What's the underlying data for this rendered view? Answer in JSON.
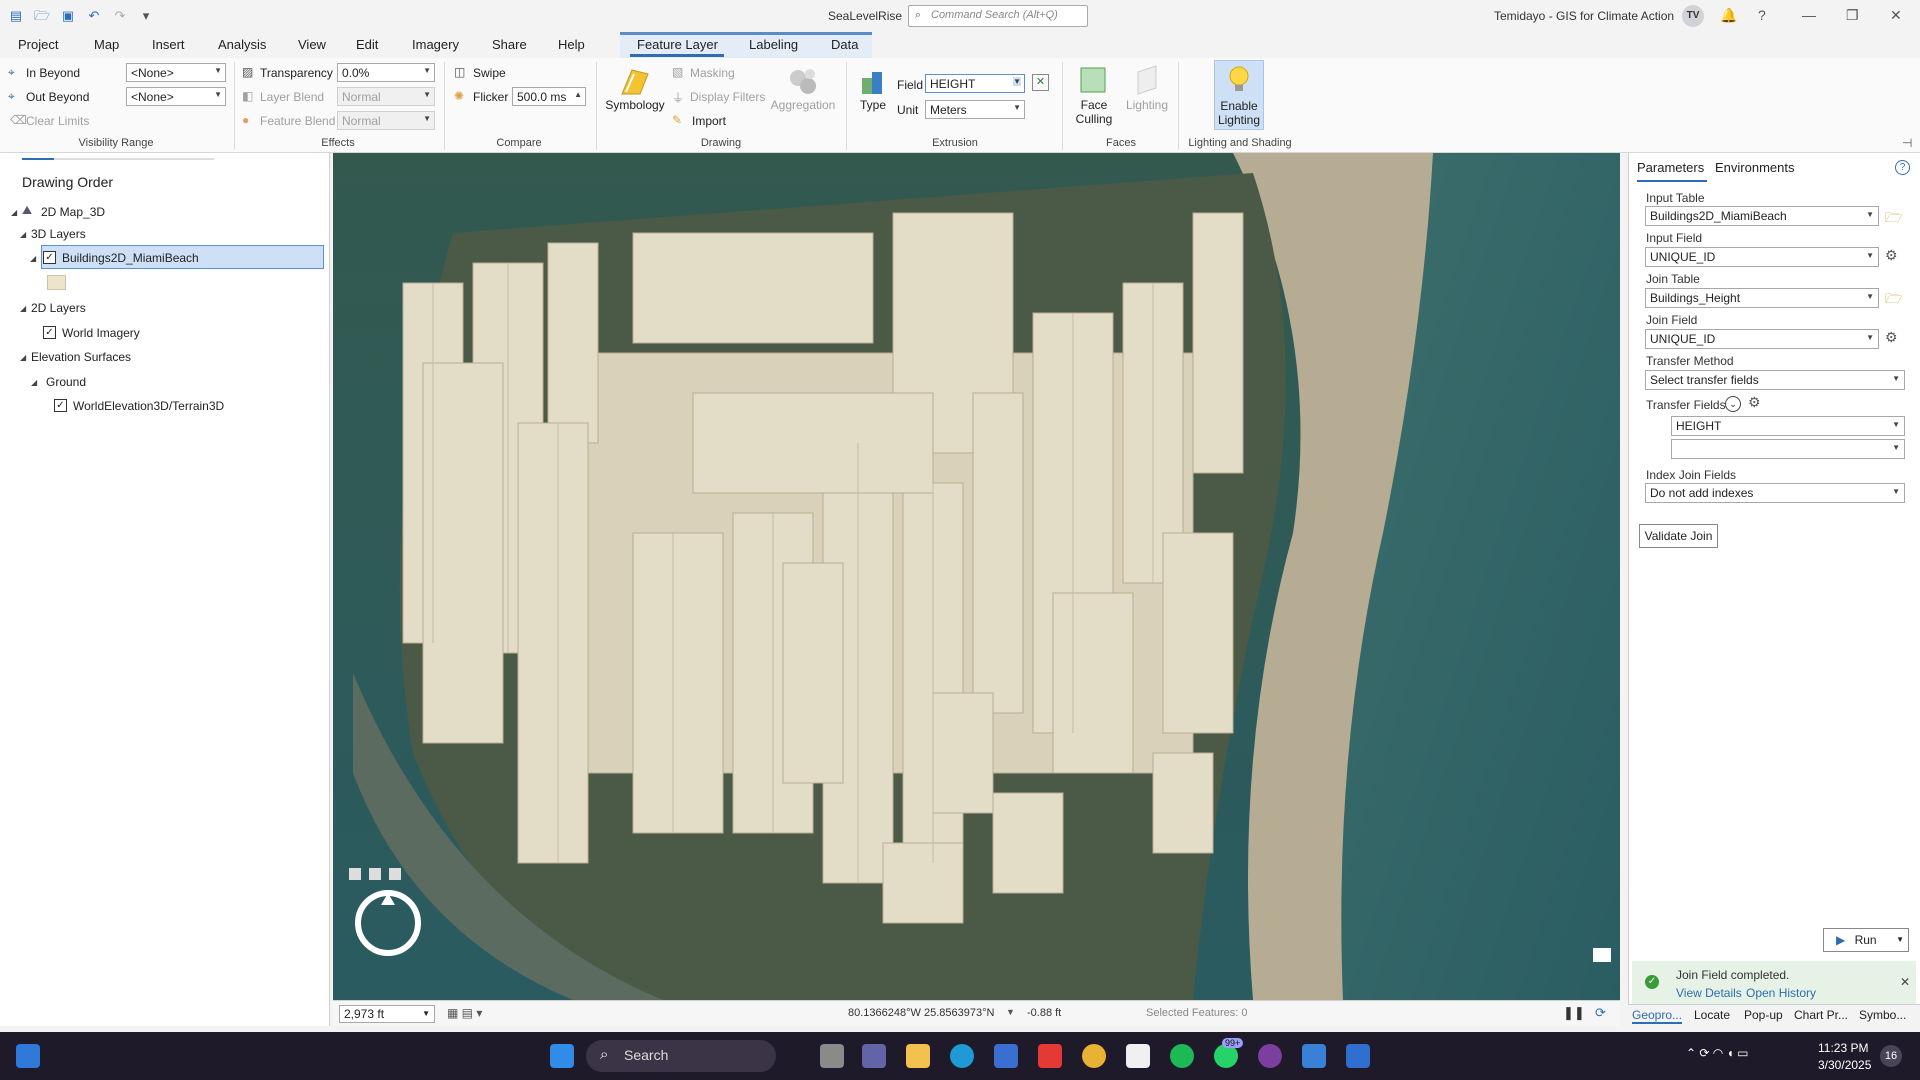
{
  "app": {
    "title": "SeaLevelRise",
    "command_search_placeholder": "Command Search (Alt+Q)",
    "user": "Temidayo - GIS for Climate Action",
    "avatar": "TV"
  },
  "ribbon_tabs": [
    "Project",
    "Map",
    "Insert",
    "Analysis",
    "View",
    "Edit",
    "Imagery",
    "Share",
    "Help",
    "Feature Layer",
    "Labeling",
    "Data"
  ],
  "ribbon": {
    "visibility": {
      "in_beyond": "In Beyond",
      "in_beyond_value": "<None>",
      "out_beyond": "Out Beyond",
      "out_beyond_value": "<None>",
      "clear_limits": "Clear Limits",
      "label": "Visibility Range"
    },
    "effects": {
      "transparency": "Transparency",
      "transparency_value": "0.0%",
      "layer_blend": "Layer Blend",
      "layer_blend_value": "Normal",
      "feature_blend": "Feature Blend",
      "feature_blend_value": "Normal",
      "label": "Effects"
    },
    "compare": {
      "swipe": "Swipe",
      "flicker": "Flicker",
      "flicker_value": "500.0 ms",
      "label": "Compare"
    },
    "drawing": {
      "symbology": "Symbology",
      "masking": "Masking",
      "display_filters": "Display Filters",
      "import": "Import",
      "aggregation": "Aggregation",
      "label": "Drawing"
    },
    "extrusion": {
      "type": "Type",
      "field": "Field",
      "field_value": "HEIGHT",
      "unit": "Unit",
      "unit_value": "Meters",
      "label": "Extrusion"
    },
    "faces": {
      "face_culling": "Face Culling",
      "lighting": "Lighting",
      "label": "Faces"
    },
    "lighting_shading": {
      "enable_lighting_1": "Enable",
      "enable_lighting_2": "Lighting",
      "label": "Lighting and Shading"
    }
  },
  "contents": {
    "heading": "Drawing Order",
    "map_name": "2D Map_3D",
    "group_3d": "3D Layers",
    "layer_buildings": "Buildings2D_MiamiBeach",
    "group_2d": "2D Layers",
    "layer_imagery": "World Imagery",
    "group_elev": "Elevation Surfaces",
    "ground": "Ground",
    "layer_terrain": "WorldElevation3D/Terrain3D"
  },
  "map_status": {
    "scale": "2,973 ft",
    "coords": "80.1366248°W 25.8563973°N",
    "elevation": "-0.88 ft",
    "selected": "Selected Features: 0"
  },
  "geoprocessing": {
    "tab_parameters": "Parameters",
    "tab_environments": "Environments",
    "input_table_label": "Input Table",
    "input_table": "Buildings2D_MiamiBeach",
    "input_field_label": "Input Field",
    "input_field": "UNIQUE_ID",
    "join_table_label": "Join Table",
    "join_table": "Buildings_Height",
    "join_field_label": "Join Field",
    "join_field": "UNIQUE_ID",
    "transfer_method_label": "Transfer Method",
    "transfer_method": "Select transfer fields",
    "transfer_fields_label": "Transfer Fields",
    "transfer_field_1": "HEIGHT",
    "transfer_field_2": "",
    "index_join_label": "Index Join Fields",
    "index_join": "Do not add indexes",
    "validate": "Validate Join",
    "run": "Run",
    "notification": "Join Field completed.",
    "view_details": "View Details",
    "open_history": "Open History"
  },
  "bottom_tabs": [
    "Geopro...",
    "Locate",
    "Pop-up",
    "Chart Pr...",
    "Symbo..."
  ],
  "taskbar": {
    "search": "Search",
    "badge": "99+",
    "time": "11:23 PM",
    "date": "3/30/2025",
    "notif_count": "16"
  },
  "colors": {
    "accent": "#2e6db4",
    "water": "#2f5f63",
    "buildings": "#e3dcc6",
    "taskbar": "#1f1a2a"
  }
}
